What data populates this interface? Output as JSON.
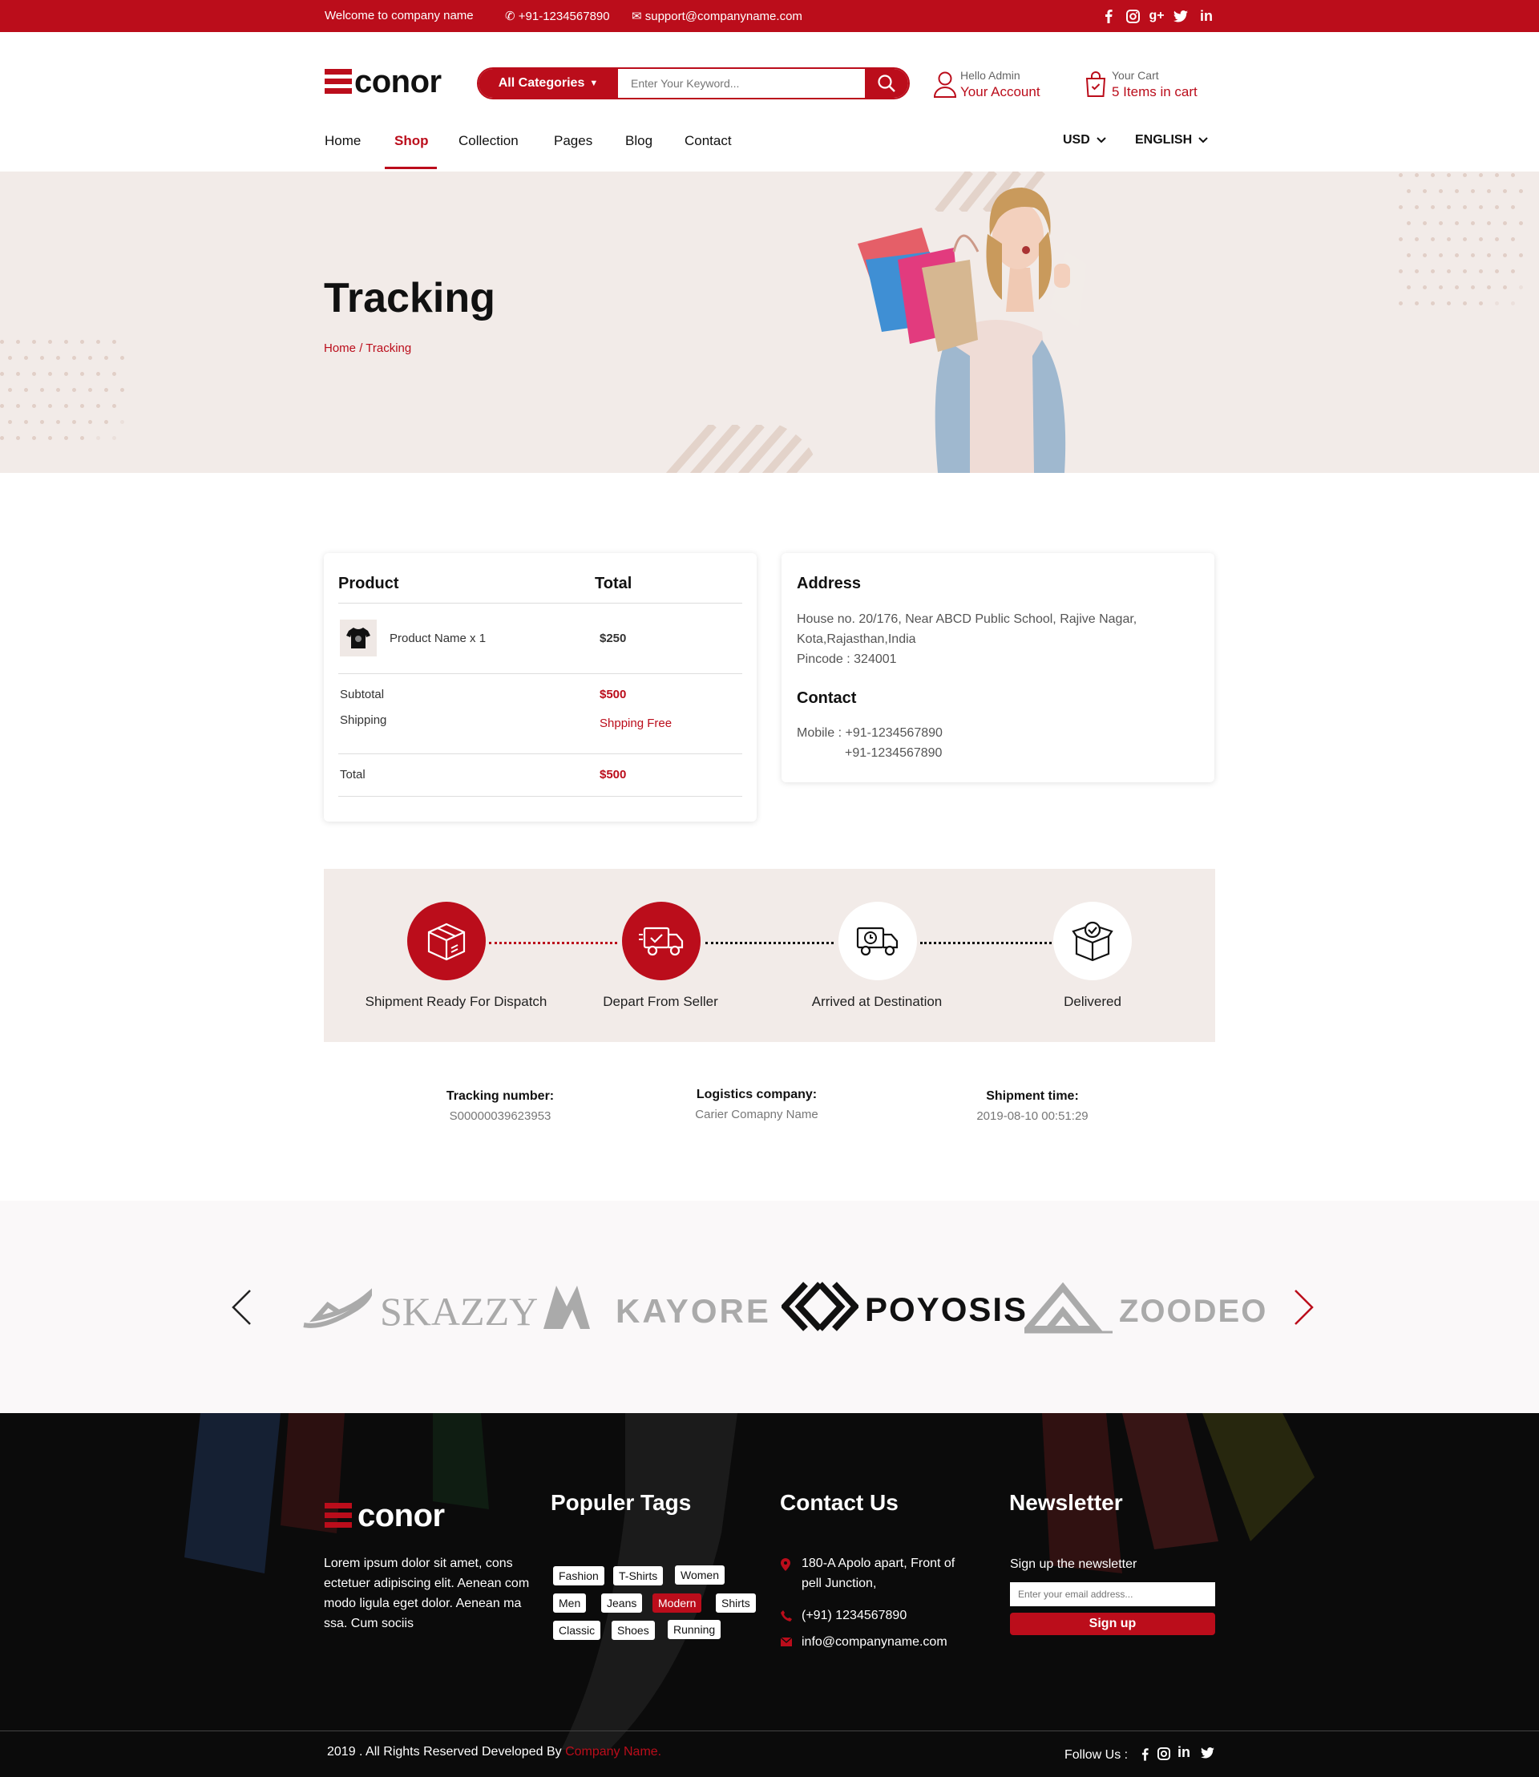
{
  "topbar": {
    "welcome": "Welcome to company name",
    "phone": "+91-1234567890",
    "email": "support@companyname.com",
    "social_icons": [
      "facebook-icon",
      "instagram-icon",
      "google-plus-icon",
      "twitter-icon",
      "linkedin-icon"
    ]
  },
  "brand": {
    "name": "conor",
    "color": "#bb0d1b"
  },
  "search": {
    "category_label": "All Categories",
    "placeholder": "Enter Your Keyword..."
  },
  "account": {
    "greeting": "Hello Admin",
    "label": "Your Account"
  },
  "cart": {
    "title": "Your Cart",
    "items": "5 Items in cart"
  },
  "nav": {
    "items": [
      "Home",
      "Shop",
      "Collection",
      "Pages",
      "Blog",
      "Contact"
    ],
    "active": "Shop",
    "currency": "USD",
    "language": "ENGLISH"
  },
  "hero": {
    "title": "Tracking",
    "breadcrumb_home": "Home",
    "breadcrumb_sep": "/",
    "breadcrumb_current": "Tracking"
  },
  "order": {
    "col_product": "Product",
    "col_total": "Total",
    "item_name": "Product Name x 1",
    "item_price": "$250",
    "subtotal_label": "Subtotal",
    "subtotal_value": "$500",
    "shipping_label": "Shipping",
    "shipping_value": "Shpping Free",
    "total_label": "Total",
    "total_value": "$500"
  },
  "address": {
    "title": "Address",
    "line1": "House no. 20/176, Near ABCD Public School, Rajive Nagar,",
    "line2": "Kota,Rajasthan,India",
    "line3": "Pincode : 324001",
    "contact_title": "Contact",
    "mobile1": "Mobile : +91-1234567890",
    "mobile2": "+91-1234567890"
  },
  "tracking": {
    "steps": [
      {
        "label": "Shipment Ready For Dispatch",
        "done": true,
        "icon": "box-icon"
      },
      {
        "label": "Depart From Seller",
        "done": true,
        "icon": "delivery-truck-icon"
      },
      {
        "label": "Arrived at Destination",
        "done": false,
        "icon": "truck-clock-icon"
      },
      {
        "label": "Delivered",
        "done": false,
        "icon": "box-check-icon"
      }
    ],
    "number_label": "Tracking number:",
    "number_value": "S00000039623953",
    "logistics_label": "Logistics company:",
    "logistics_value": "Carier Comapny Name",
    "time_label": "Shipment time:",
    "time_value": "2019-08-10 00:51:29"
  },
  "brands": [
    "SKAZZY",
    "KAYORE",
    "POYOSIS",
    "ZOODEO"
  ],
  "footer": {
    "about": "Lorem ipsum dolor sit amet, cons ectetuer adipiscing elit. Aenean com modo ligula eget dolor. Aenean ma ssa. Cum sociis",
    "tags_title": "Populer Tags",
    "tags": [
      "Fashion",
      "T-Shirts",
      "Women",
      "Men",
      "Jeans",
      "Modern",
      "Shirts",
      "Classic",
      "Shoes",
      "Running"
    ],
    "highlighted_tag": "Modern",
    "contact_title": "Contact Us",
    "contact_address_1": "180-A Apolo apart, Front of",
    "contact_address_2": "pell Junction,",
    "contact_phone": "(+91) 1234567890",
    "contact_email": "info@companyname.com",
    "newsletter_title": "Newsletter",
    "newsletter_text": "Sign up the newsletter",
    "newsletter_placeholder": "Enter your email address...",
    "newsletter_button": "Sign up",
    "copyright_prefix": "2019 . All Rights Reserved Developed By",
    "copyright_company": "Company Name.",
    "follow_label": "Follow Us :"
  }
}
